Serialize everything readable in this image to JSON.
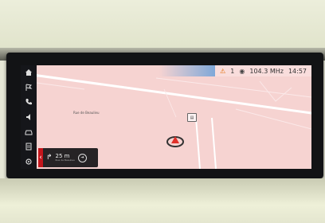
{
  "status_bar": {
    "alert_icon": "warning-triangle-icon",
    "alert_count": "1",
    "radio_icon": "radio-icon",
    "frequency": "104.3 MHz",
    "time": "14:57"
  },
  "side_menu": [
    {
      "name": "home-icon"
    },
    {
      "name": "flag-icon"
    },
    {
      "name": "phone-icon"
    },
    {
      "name": "media-icon"
    },
    {
      "name": "car-icon"
    },
    {
      "name": "notes-icon"
    },
    {
      "name": "settings-icon"
    }
  ],
  "map": {
    "street_label": "Rue de Beaulieu",
    "background_color": "#f6d3d1",
    "road_color": "#ffffff"
  },
  "navigation": {
    "distance": "25 m",
    "sub_text": "Rue de Beaulieu"
  },
  "colors": {
    "accent_red": "#c4161c",
    "warning_orange": "#e06a00",
    "bezel": "#121315"
  }
}
